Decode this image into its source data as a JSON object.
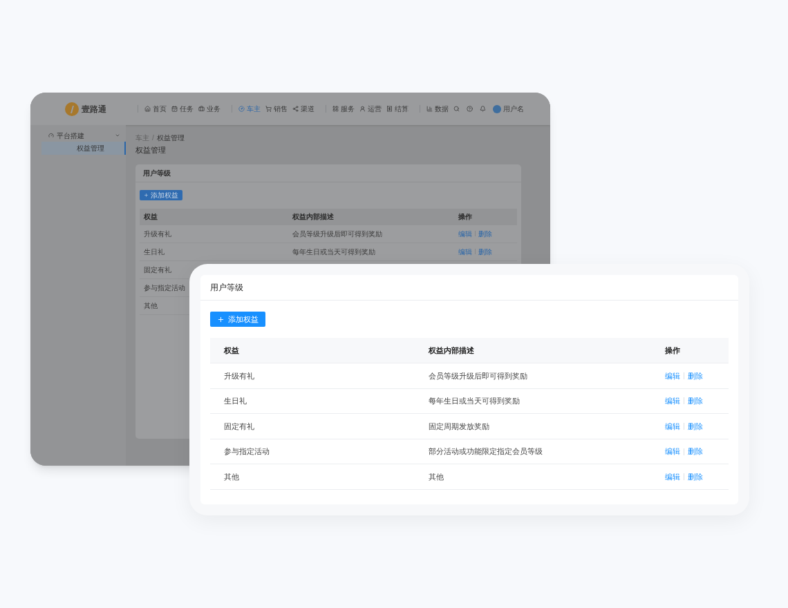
{
  "back_window": {
    "logo": {
      "name": "壹路通"
    },
    "nav_groups": [
      [
        {
          "label": "首页",
          "selected": false
        },
        {
          "label": "任务",
          "selected": false
        },
        {
          "label": "业务",
          "selected": false
        }
      ],
      [
        {
          "label": "车主",
          "selected": true
        },
        {
          "label": "销售",
          "selected": false
        },
        {
          "label": "渠道",
          "selected": false
        }
      ],
      [
        {
          "label": "服务",
          "selected": false
        },
        {
          "label": "运营",
          "selected": false
        },
        {
          "label": "结算",
          "selected": false
        }
      ],
      [
        {
          "label": "数据",
          "selected": false
        }
      ]
    ],
    "user": {
      "name": "用户名"
    },
    "sidebar": {
      "items": [
        {
          "label": "平台搭建",
          "expanded": true,
          "children": [
            {
              "label": "权益管理",
              "selected": true
            }
          ]
        }
      ]
    },
    "breadcrumb": [
      "车主",
      "权益管理"
    ],
    "breadcrumb_separator": "/",
    "page_title": "权益管理",
    "card": {
      "title": "用户等级",
      "add_button": "添加权益",
      "table": {
        "columns": [
          "权益",
          "权益内部描述",
          "操作"
        ],
        "rows": [
          {
            "name": "升级有礼",
            "description": "会员等级升级后即可得到奖励",
            "actions": [
              "编辑",
              "删除"
            ]
          },
          {
            "name": "生日礼",
            "description": "每年生日或当天可得到奖励",
            "actions": [
              "编辑",
              "删除"
            ]
          },
          {
            "name": "固定有礼"
          },
          {
            "name": "参与指定活动"
          },
          {
            "name": "其他"
          }
        ]
      }
    }
  },
  "front_card": {
    "title": "用户等级",
    "add_button": "添加权益",
    "table": {
      "columns": [
        "权益",
        "权益内部描述",
        "操作"
      ],
      "rows": [
        {
          "name": "升级有礼",
          "description": "会员等级升级后即可得到奖励",
          "actions": [
            "编辑",
            "删除"
          ]
        },
        {
          "name": "生日礼",
          "description": "每年生日或当天可得到奖励",
          "actions": [
            "编辑",
            "删除"
          ]
        },
        {
          "name": "固定有礼",
          "description": "固定周期发放奖励",
          "actions": [
            "编辑",
            "删除"
          ]
        },
        {
          "name": "参与指定活动",
          "description": "部分活动或功能限定指定会员等级",
          "actions": [
            "编辑",
            "删除"
          ]
        },
        {
          "name": "其他",
          "description": "其他",
          "actions": [
            "编辑",
            "删除"
          ]
        }
      ]
    }
  }
}
